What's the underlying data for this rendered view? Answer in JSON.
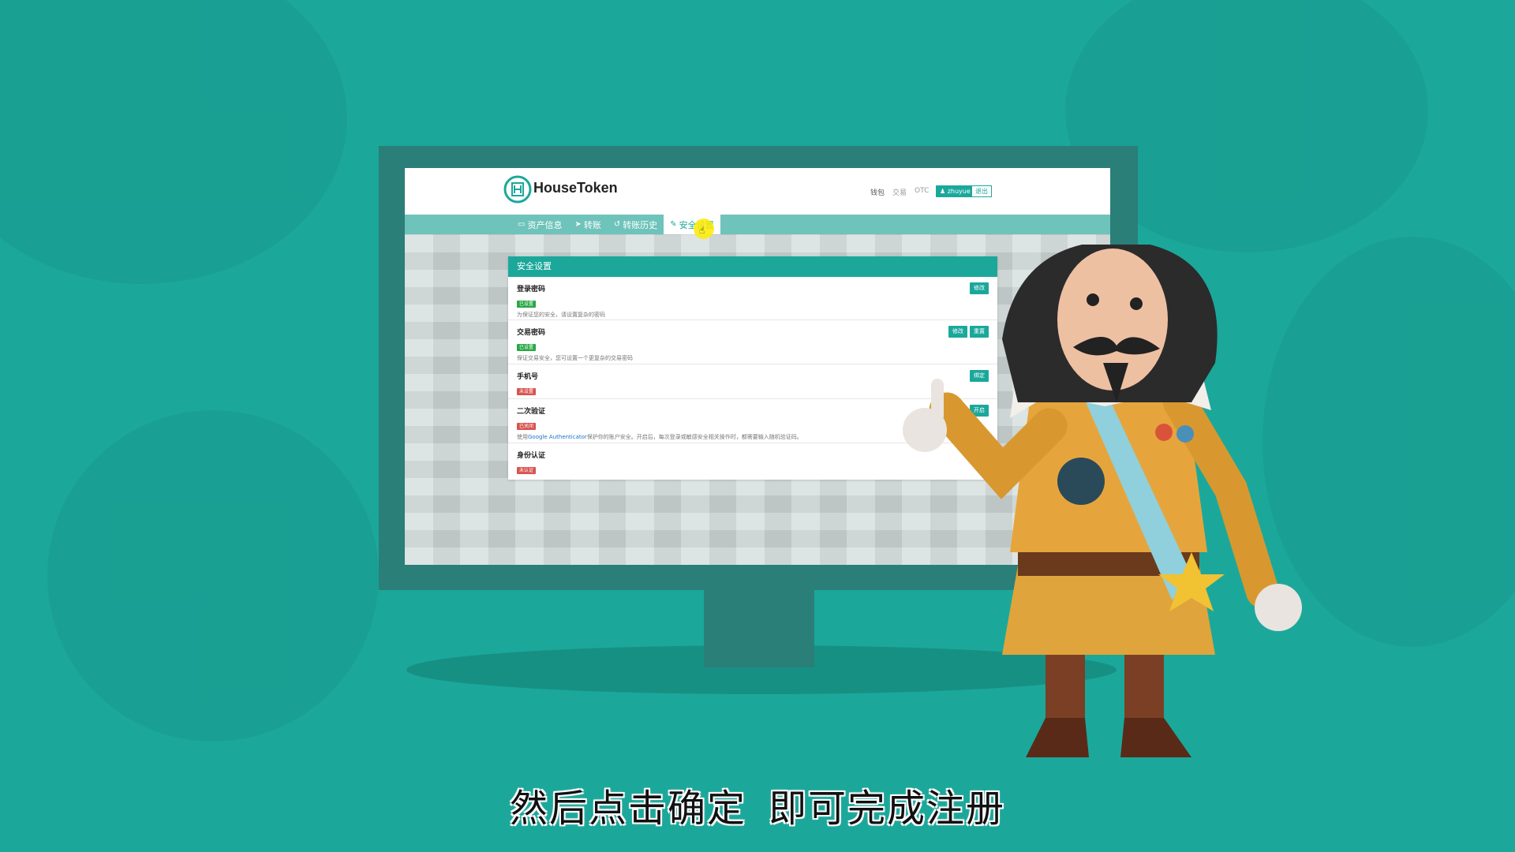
{
  "site": {
    "brand": "HouseToken",
    "top_links": [
      "钱包",
      "交易",
      "OTC"
    ],
    "user_label": "zhuyue",
    "logout_label": "退出"
  },
  "nav": {
    "items": [
      {
        "icon": "wallet-icon",
        "label": "资产信息"
      },
      {
        "icon": "send-icon",
        "label": "转账"
      },
      {
        "icon": "history-icon",
        "label": "转账历史"
      },
      {
        "icon": "wrench-icon",
        "label": "安全设置",
        "active": true
      }
    ]
  },
  "panel": {
    "title": "安全设置",
    "rows": [
      {
        "title": "登录密码",
        "badge": "已设置",
        "status": "ok",
        "desc": "为保证您的安全，请设置复杂的密码",
        "buttons": [
          "修改"
        ]
      },
      {
        "title": "交易密码",
        "badge": "已设置",
        "status": "ok",
        "desc": "保证交易安全，您可设置一个更复杂的交易密码",
        "buttons": [
          "修改",
          "重置"
        ]
      },
      {
        "title": "手机号",
        "badge": "未设置",
        "status": "bad",
        "desc": "",
        "buttons": [
          "绑定"
        ]
      },
      {
        "title": "二次验证",
        "badge": "已关闭",
        "status": "bad",
        "desc_pre": "使用",
        "desc_link": "Google Authenticator",
        "desc_post": "保护你的账户安全。开启后，每次登录或敏感安全相关操作时，都需要输入随机验证码。",
        "buttons": [
          "开启"
        ]
      },
      {
        "title": "身份认证",
        "badge": "未认证",
        "status": "bad",
        "desc": "",
        "buttons": [
          "验证"
        ]
      }
    ]
  },
  "subtitle": {
    "part1": "然后点击确定",
    "part2": "即可完成注册"
  },
  "colors": {
    "background": "#1ba89b",
    "accent": "#1ba89b",
    "nav": "#6ec3ba",
    "ok": "#28a745",
    "bad": "#d9534f"
  }
}
